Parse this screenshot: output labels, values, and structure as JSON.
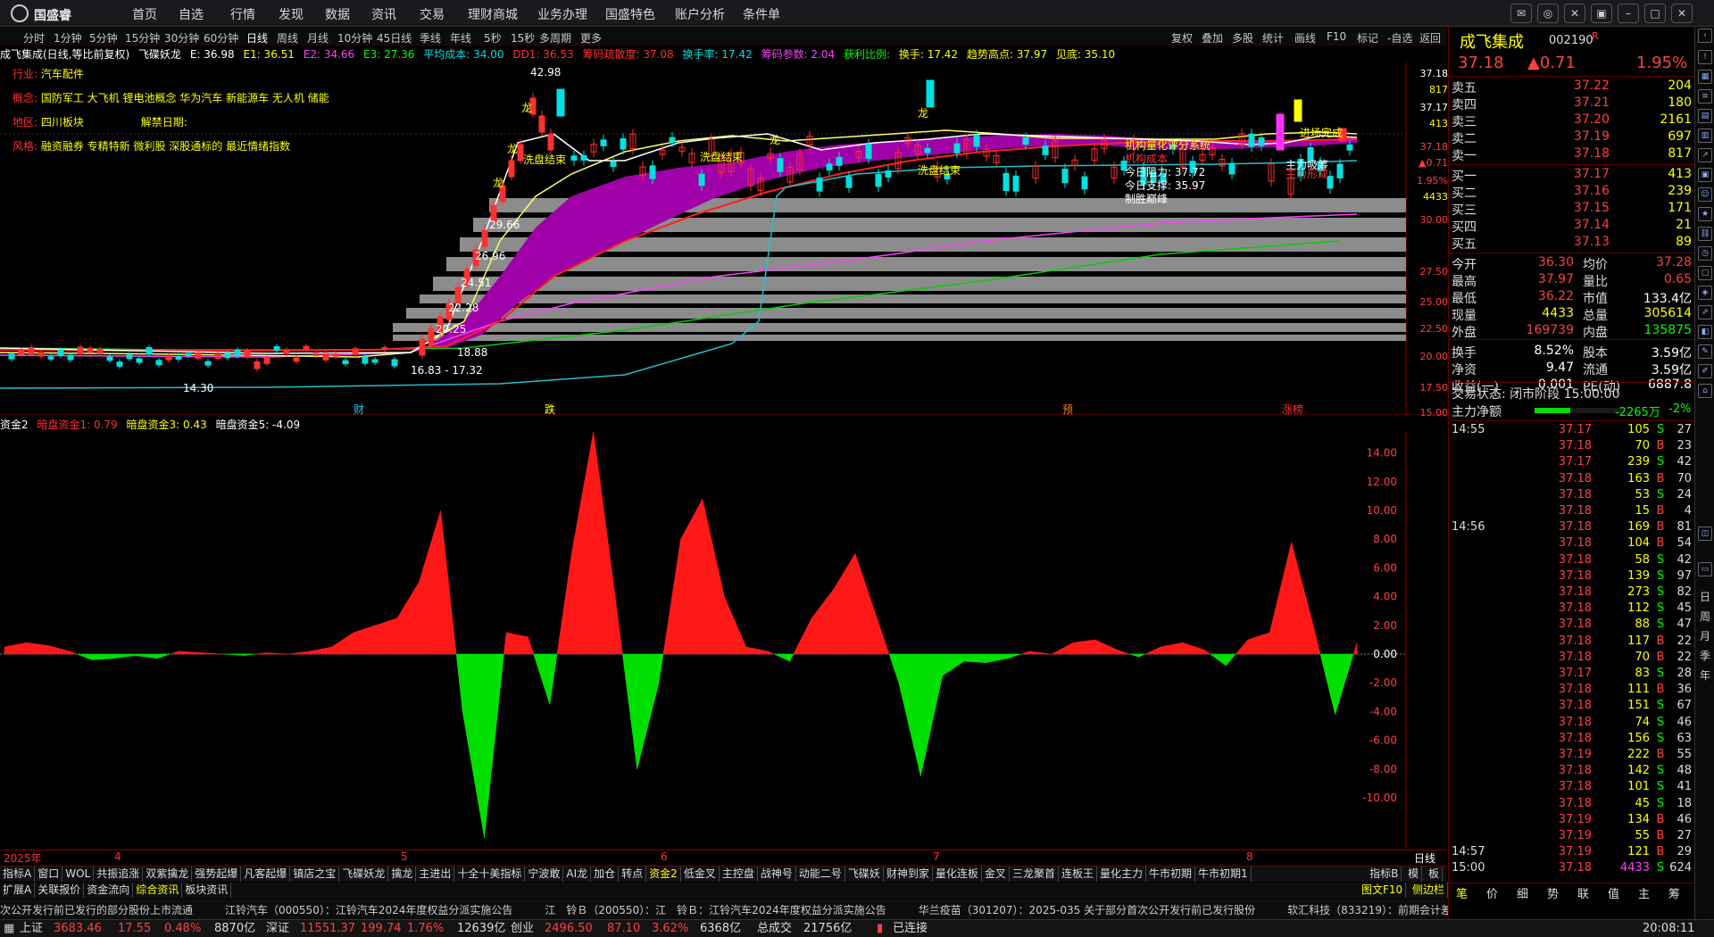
{
  "app": {
    "logo_text": "国盛睿",
    "menu": [
      "首页",
      "自选",
      "行情",
      "发现",
      "数据",
      "资讯",
      "交易",
      "理财商城",
      "业务办理",
      "国盛特色",
      "账户分析",
      "条件单"
    ]
  },
  "periods": [
    "分时",
    "1分钟",
    "5分钟",
    "15分钟",
    "30分钟",
    "60分钟",
    "日线",
    "周线",
    "月线",
    "10分钟",
    "45日线",
    "季线",
    "年线",
    "5秒",
    "15秒",
    "多周期",
    "更多"
  ],
  "period_active": "日线",
  "toolbar_right": [
    "复权",
    "叠加",
    "多股",
    "统计",
    "画线",
    "F10",
    "标记",
    "-自选",
    "返回"
  ],
  "chart_info": {
    "name": "成飞集成(日线,等比前复权)",
    "indicator": "飞碟妖龙",
    "E": "E: 36.98",
    "E1": "E1: 36.51",
    "E2": "E2: 34.66",
    "E3": "E3: 27.36",
    "avg_cost": "平均成本: 34.00",
    "dd1": "DD1: 36.53",
    "disperse": "筹码疏散度: 37.08",
    "turnover": "换手率: 17.42",
    "chip_ref": "筹码参数: 2.04",
    "profit": "获利比例: ",
    "turnover2": "换手: 17.42",
    "trend_high": "趋势高点: 37.97",
    "bottom": "见底: 35.10"
  },
  "stock_info": {
    "industry_label": "行业: ",
    "industry": "汽车配件",
    "concept_label": "概念: ",
    "concept": "国防军工 大飞机 锂电池概念 华为汽车 新能源车 无人机 储能",
    "region_label": "地区: ",
    "region": "四川板块",
    "unlock_label": "解禁日期: ",
    "style_label": "风格: ",
    "style": "融资融券 专精特新 微利股 深股通标的 最近情绪指数"
  },
  "annotations": {
    "high_price": "42.98",
    "low_price": "14.30",
    "range_low": "16.83 - 17.32",
    "wash_end": "洗盘结束",
    "inst_score": "机构量化评分系统",
    "inst_cost": "机构成本",
    "today_pressure": "今日阻力: 37.72",
    "today_support": "今日支撑: 35.97",
    "decisive": "制胜巅峰",
    "main_absorb": "主力吸筹",
    "main_form": "主力形成",
    "entry_done": "进场完成",
    "dragon": "龙",
    "lvl1": "29.66",
    "lvl2": "26.96",
    "lvl3": "24.51",
    "lvl4": "22.28",
    "lvl5": "20.25",
    "lvl6": "18.88",
    "marks": [
      "财",
      "跌",
      "预",
      "涨榜"
    ]
  },
  "price_axis": [
    "37.18",
    "817",
    "37.17",
    "413",
    "37.18",
    "▲0.71",
    "1.95%",
    "4433",
    "30.00",
    "27.50",
    "25.00",
    "22.50",
    "20.00",
    "17.50",
    "15.00"
  ],
  "lower_info": {
    "name": "资金2",
    "f1": "暗盘资金1: 0.79",
    "f3": "暗盘资金3: 0.43",
    "f5": "暗盘资金5: -4.09"
  },
  "lower_axis": [
    "14.00",
    "12.00",
    "10.00",
    "8.00",
    "6.00",
    "4.00",
    "2.00",
    "0.00",
    "-2.00",
    "-4.00",
    "-6.00",
    "-8.00",
    "-10.00"
  ],
  "x_axis": [
    "2025年",
    "4",
    "5",
    "6",
    "7",
    "8"
  ],
  "x_period": "日线",
  "chart_data": {
    "type": "area",
    "title": "资金2",
    "x": [
      "2025年",
      "4",
      "5",
      "6",
      "7",
      "8"
    ],
    "ylim": [
      -12,
      15
    ],
    "series": [
      {
        "name": "暗盘资金1",
        "values": [
          0.5,
          0.8,
          0.6,
          0.2,
          -0.4,
          -0.3,
          -0.1,
          -0.3,
          0.2,
          0.1,
          0.0,
          -0.1,
          0.1,
          0.0,
          0.2,
          0.5,
          1.5,
          2.0,
          2.5,
          5.0,
          10.0,
          -4.0,
          -12.8,
          1.5,
          1.2,
          -3.5,
          7.0,
          15.5,
          4.0,
          -8.0,
          -2.0,
          8.0,
          10.8,
          4.0,
          0.5,
          0.2,
          -0.5,
          2.5,
          4.5,
          7.0,
          2.5,
          -2.0,
          -8.5,
          -1.5,
          -0.5,
          -0.6,
          -0.3,
          0.2,
          0.0,
          0.8,
          1.0,
          0.3,
          -0.2,
          0.5,
          0.8,
          0.3,
          -0.8,
          1.0,
          1.5,
          7.8,
          2.0,
          -4.2,
          0.79
        ]
      }
    ]
  },
  "quote": {
    "name": "成飞集成",
    "code": "002190",
    "flag": "R",
    "price": "37.18",
    "change": "▲0.71",
    "pct": "1.95%",
    "asks": [
      {
        "label": "卖五",
        "price": "37.22",
        "vol": "204"
      },
      {
        "label": "卖四",
        "price": "37.21",
        "vol": "180"
      },
      {
        "label": "卖三",
        "price": "37.20",
        "vol": "2161"
      },
      {
        "label": "卖二",
        "price": "37.19",
        "vol": "697"
      },
      {
        "label": "卖一",
        "price": "37.18",
        "vol": "817"
      }
    ],
    "bids": [
      {
        "label": "买一",
        "price": "37.17",
        "vol": "413"
      },
      {
        "label": "买二",
        "price": "37.16",
        "vol": "239"
      },
      {
        "label": "买三",
        "price": "37.15",
        "vol": "171"
      },
      {
        "label": "买四",
        "price": "37.14",
        "vol": "21"
      },
      {
        "label": "买五",
        "price": "37.13",
        "vol": "89"
      }
    ],
    "stats": [
      {
        "l1": "今开",
        "v1": "36.30",
        "l2": "均价",
        "v2": "37.28"
      },
      {
        "l1": "最高",
        "v1": "37.97",
        "l2": "量比",
        "v2": "0.65"
      },
      {
        "l1": "最低",
        "v1": "36.22",
        "l2": "市值",
        "v2": "133.4亿"
      },
      {
        "l1": "现量",
        "v1": "4433",
        "l2": "总量",
        "v2": "305614"
      },
      {
        "l1": "外盘",
        "v1": "169739",
        "l2": "内盘",
        "v2": "135875"
      },
      {
        "l1": "换手",
        "v1": "8.52%",
        "l2": "股本",
        "v2": "3.59亿"
      },
      {
        "l1": "净资",
        "v1": "9.47",
        "l2": "流通",
        "v2": "3.59亿"
      },
      {
        "l1": "收益(一)",
        "v1": "0.001",
        "l2": "PE(动)",
        "v2": "6887.8"
      }
    ],
    "trade_status": "交易状态: 闭市阶段 15:00:00",
    "main_net_label": "主力净额",
    "main_net": "-2265万",
    "main_pct": "-2%",
    "main_net_bar": 0.4
  },
  "ticks": [
    {
      "t": "14:55",
      "p": "37.17",
      "v": "105",
      "s": "S",
      "n": "27"
    },
    {
      "t": "",
      "p": "37.18",
      "v": "70",
      "s": "B",
      "n": "23"
    },
    {
      "t": "",
      "p": "37.17",
      "v": "239",
      "s": "S",
      "n": "42"
    },
    {
      "t": "",
      "p": "37.18",
      "v": "163",
      "s": "B",
      "n": "70"
    },
    {
      "t": "",
      "p": "37.18",
      "v": "53",
      "s": "S",
      "n": "24"
    },
    {
      "t": "",
      "p": "37.18",
      "v": "15",
      "s": "B",
      "n": "4"
    },
    {
      "t": "14:56",
      "p": "37.18",
      "v": "169",
      "s": "B",
      "n": "81"
    },
    {
      "t": "",
      "p": "37.18",
      "v": "104",
      "s": "B",
      "n": "54"
    },
    {
      "t": "",
      "p": "37.18",
      "v": "58",
      "s": "S",
      "n": "42"
    },
    {
      "t": "",
      "p": "37.18",
      "v": "139",
      "s": "S",
      "n": "97"
    },
    {
      "t": "",
      "p": "37.18",
      "v": "273",
      "s": "S",
      "n": "82"
    },
    {
      "t": "",
      "p": "37.18",
      "v": "112",
      "s": "S",
      "n": "45"
    },
    {
      "t": "",
      "p": "37.18",
      "v": "88",
      "s": "S",
      "n": "47"
    },
    {
      "t": "",
      "p": "37.18",
      "v": "117",
      "s": "B",
      "n": "22"
    },
    {
      "t": "",
      "p": "37.18",
      "v": "70",
      "s": "B",
      "n": "22"
    },
    {
      "t": "",
      "p": "37.17",
      "v": "83",
      "s": "S",
      "n": "28"
    },
    {
      "t": "",
      "p": "37.18",
      "v": "111",
      "s": "B",
      "n": "36"
    },
    {
      "t": "",
      "p": "37.18",
      "v": "151",
      "s": "S",
      "n": "67"
    },
    {
      "t": "",
      "p": "37.18",
      "v": "74",
      "s": "S",
      "n": "46"
    },
    {
      "t": "",
      "p": "37.18",
      "v": "156",
      "s": "S",
      "n": "63"
    },
    {
      "t": "",
      "p": "37.19",
      "v": "222",
      "s": "B",
      "n": "55"
    },
    {
      "t": "",
      "p": "37.18",
      "v": "142",
      "s": "S",
      "n": "48"
    },
    {
      "t": "",
      "p": "37.18",
      "v": "101",
      "s": "S",
      "n": "41"
    },
    {
      "t": "",
      "p": "37.18",
      "v": "45",
      "s": "S",
      "n": "18"
    },
    {
      "t": "",
      "p": "37.19",
      "v": "134",
      "s": "B",
      "n": "46"
    },
    {
      "t": "",
      "p": "37.19",
      "v": "55",
      "s": "B",
      "n": "27"
    },
    {
      "t": "14:57",
      "p": "37.19",
      "v": "121",
      "s": "B",
      "n": "29"
    },
    {
      "t": "15:00",
      "p": "37.18",
      "v": "4433",
      "s": "S",
      "n": "624"
    }
  ],
  "side_chars": [
    "日",
    "周",
    "月",
    "季",
    "年"
  ],
  "quote_tabs": [
    "笔",
    "价",
    "细",
    "势",
    "联",
    "值",
    "主",
    "筹"
  ],
  "indicator_tabs": [
    "指标A",
    "窗口",
    "WOL",
    "共振追涨",
    "双紫擒龙",
    "强势起爆",
    "凡客起爆",
    "镇店之宝",
    "飞碟妖龙",
    "擒龙",
    "主进出",
    "十全十美指标",
    "宁波敢",
    "AI龙",
    "加仓",
    "转点",
    "资金2",
    "低金叉",
    "主控盘",
    "战神号",
    "动能二号",
    "飞碟妖",
    "财神到家",
    "量化连板",
    "金叉",
    "三龙聚首",
    "连板王",
    "量化主力",
    "牛市初期",
    "牛市初期1"
  ],
  "indicator_active": "资金2",
  "tab_right": [
    "指标B",
    "模",
    "板"
  ],
  "bottom_tabs": [
    "扩展A",
    "关联报价",
    "资金流向",
    "综合资讯",
    "板块资讯"
  ],
  "bottom_right": [
    "图文F10",
    "侧边栏"
  ],
  "news": [
    "次公开发行前已发行的部分股份上市流通",
    "江铃汽车（000550）：江铃汽车2024年度权益分派实施公告",
    "江　铃Ｂ（200550）：江　铃Ｂ：江铃汽车2024年度权益分派实施公告",
    "华兰疫苗（301207）：2025-035 关于部分首次公开发行前已发行股份",
    "软汇科技（833219）：前期会计差错更正公告",
    "翰天智能（872235）：2025年半年度"
  ],
  "status": {
    "sh_label": "上证",
    "sh_val": "3683.46",
    "sh_chg": "17.55",
    "sh_pct": "0.48%",
    "sh_amt": "8870亿",
    "sz_label": "深证",
    "sz_val": "11551.37",
    "sz_chg": "199.74",
    "sz_pct": "1.76%",
    "sz_amt": "12639亿",
    "cy_label": "创业",
    "cy_val": "2496.50",
    "cy_chg": "87.10",
    "cy_pct": "3.62%",
    "cy_amt": "6368亿",
    "total_label": "总成交",
    "total_amt": "21756亿",
    "conn": "已连接",
    "time": "20:08:11"
  }
}
